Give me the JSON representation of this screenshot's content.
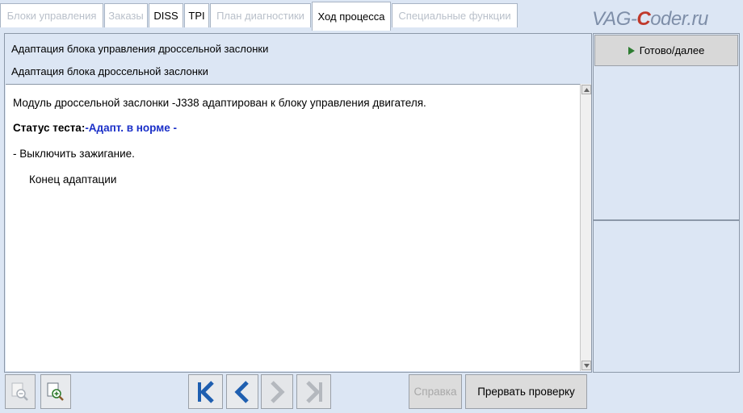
{
  "tabs": [
    {
      "label": "Блоки управления",
      "state": "disabled"
    },
    {
      "label": "Заказы",
      "state": "disabled"
    },
    {
      "label": "DISS",
      "state": "enabled"
    },
    {
      "label": "TPI",
      "state": "enabled"
    },
    {
      "label": "План диагностики",
      "state": "disabled"
    },
    {
      "label": "Ход процесса",
      "state": "active"
    },
    {
      "label": "Специальные функции",
      "state": "disabled"
    }
  ],
  "watermark": {
    "prefix": "VAG-",
    "highlight": "C",
    "suffix": "oder.ru"
  },
  "header": {
    "line1": "Адаптация блока управления дроссельной заслонки",
    "line2": "Адаптация блока дроссельной заслонки"
  },
  "content": {
    "line1": "Модуль дроссельной заслонки -J338 адаптирован к блоку управления двигателя.",
    "status_label": "Статус теста:",
    "status_value": "-Адапт. в норме -",
    "line3": "- Выключить зажигание.",
    "line4": "Конец адаптации"
  },
  "side": {
    "next_label": "Готово/далее"
  },
  "toolbar": {
    "help_label": "Справка",
    "abort_label": "Прервать проверку"
  },
  "icons": {
    "zoom_out": "zoom-out-icon",
    "zoom_in": "zoom-in-icon",
    "first": "first-page-icon",
    "prev": "previous-page-icon",
    "next": "next-page-icon",
    "last": "last-page-icon"
  },
  "colors": {
    "accent_blue": "#1a2fc8",
    "nav_blue": "#1f5fb0",
    "play_green": "#2e7d32",
    "watermark_red": "#c0392b"
  }
}
